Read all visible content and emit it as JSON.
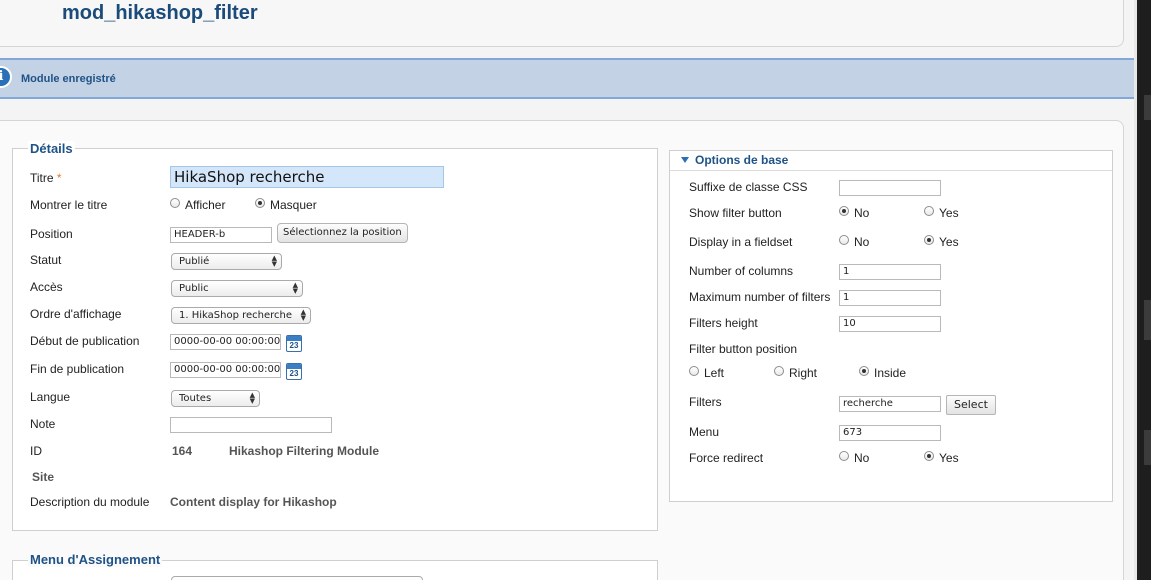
{
  "header": {
    "title": "mod_hikashop_filter"
  },
  "message": {
    "icon": "info-icon",
    "text": "Module enregistré"
  },
  "details": {
    "legend": "Détails",
    "fields": {
      "title_label": "Titre",
      "title_required": "*",
      "title_value": "HikaShop recherche",
      "show_title_label": "Montrer le titre",
      "show_title_options": [
        "Afficher",
        "Masquer"
      ],
      "show_title_selected": "Masquer",
      "position_label": "Position",
      "position_value": "HEADER-b",
      "position_button": "Sélectionnez la position",
      "status_label": "Statut",
      "status_value": "Publié",
      "access_label": "Accès",
      "access_value": "Public",
      "order_label": "Ordre d'affichage",
      "order_value": "1. HikaShop recherche",
      "publish_start_label": "Début de publication",
      "publish_start_value": "0000-00-00 00:00:00",
      "publish_end_label": "Fin de publication",
      "publish_end_value": "0000-00-00 00:00:00",
      "calendar_day": "23",
      "language_label": "Langue",
      "language_value": "Toutes",
      "note_label": "Note",
      "note_value": "",
      "id_label": "ID",
      "id_value": "164",
      "module_name": "Hikashop Filtering Module",
      "site_label": "Site",
      "description_label": "Description du module",
      "description_value": "Content display for Hikashop"
    }
  },
  "options": {
    "title": "Options de base",
    "css_suffix_label": "Suffixe de classe CSS",
    "css_suffix_value": "",
    "show_filter_button_label": "Show filter button",
    "show_filter_button_selected": "No",
    "display_fieldset_label": "Display in a fieldset",
    "display_fieldset_selected": "Yes",
    "columns_label": "Number of columns",
    "columns_value": "1",
    "max_filters_label": "Maximum number of filters",
    "max_filters_value": "1",
    "filters_height_label": "Filters height",
    "filters_height_value": "10",
    "filter_button_position_label": "Filter button position",
    "position_options": [
      "Left",
      "Right",
      "Inside"
    ],
    "position_selected": "Inside",
    "filters_label": "Filters",
    "filters_value": "recherche",
    "filters_button": "Select",
    "menu_label": "Menu",
    "menu_value": "673",
    "force_redirect_label": "Force redirect",
    "force_redirect_selected": "Yes",
    "no_label": "No",
    "yes_label": "Yes"
  },
  "assignment": {
    "legend": "Menu d'Assignement"
  }
}
